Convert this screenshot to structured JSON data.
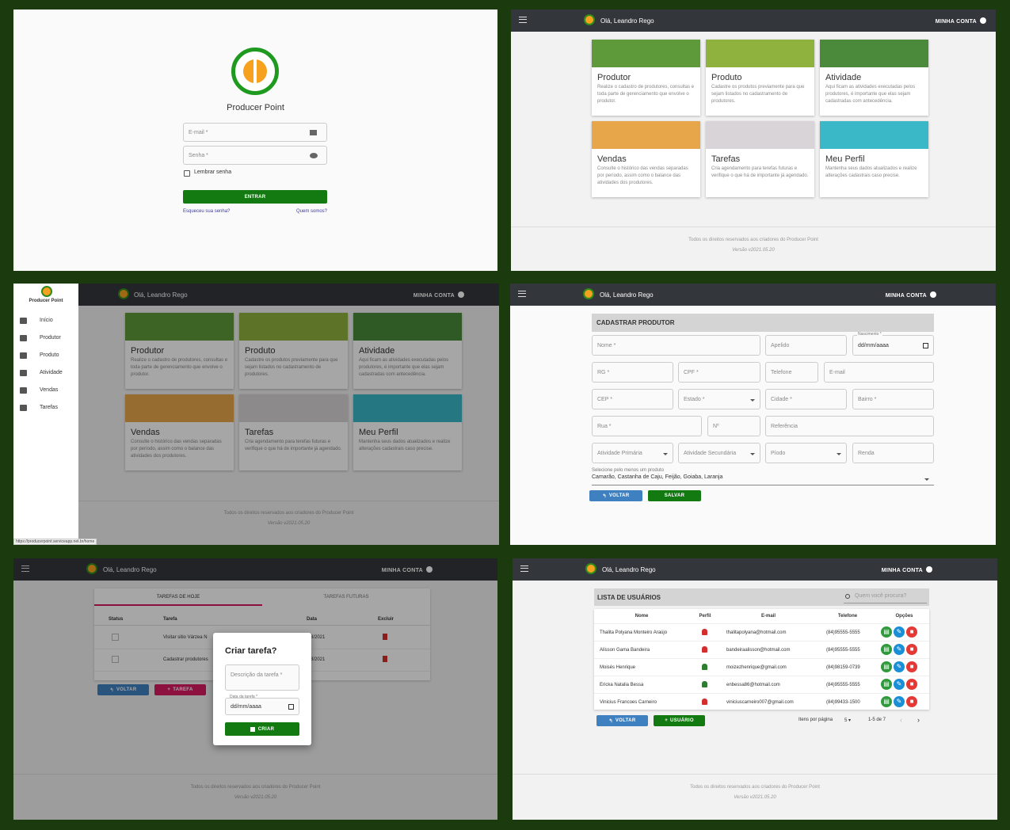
{
  "login": {
    "app_name": "Producer Point",
    "email_placeholder": "E-mail *",
    "password_placeholder": "Senha *",
    "remember_label": "Lembrar senha",
    "enter_button": "ENTRAR",
    "forgot_link": "Esqueceu sua senha?",
    "about_link": "Quem somos?"
  },
  "topbar": {
    "greeting": "Olá, Leandro Rego",
    "account": "MINHA CONTA"
  },
  "home_cards": [
    {
      "title": "Produtor",
      "desc": "Realize o cadastro de produtores, consultas e toda parte de gerenciamento que envolve o produtor.",
      "img_color": "#5e9a3a"
    },
    {
      "title": "Produto",
      "desc": "Cadastre os produtos previamente para que sejam listados no cadastramento de produtores.",
      "img_color": "#8fb23e"
    },
    {
      "title": "Atividade",
      "desc": "Aqui ficam as atividades executadas pelos produtores, é importante que elas sejam cadastradas com antecedência.",
      "img_color": "#4a8a3a"
    },
    {
      "title": "Vendas",
      "desc": "Consulte o histórico das vendas separadas por período, assim como o balance das atividades dos produtores.",
      "img_color": "#e8a64a"
    },
    {
      "title": "Tarefas",
      "desc": "Cria agendamento para terefas futuras e verifique o que há de importante já agendado.",
      "img_color": "#d9d4d8"
    },
    {
      "title": "Meu Perfil",
      "desc": "Mantenha seus dados atualizados e realize alterações cadastrais caso precise.",
      "img_color": "#3ab8c8"
    }
  ],
  "footer": {
    "rights": "Todos os direitos reservados aos criadores do Producer Point",
    "version": "Versão v2021.05.20"
  },
  "sidebar": {
    "brand": "Producer Point",
    "items": [
      {
        "label": "Início",
        "icon": "home-icon"
      },
      {
        "label": "Produtor",
        "icon": "hat-icon"
      },
      {
        "label": "Produto",
        "icon": "bowl-icon"
      },
      {
        "label": "Atividade",
        "icon": "briefcase-icon"
      },
      {
        "label": "Vendas",
        "icon": "trending-up-icon"
      },
      {
        "label": "Tarefas",
        "icon": "clipboard-icon"
      }
    ],
    "status_url": "https://producerpoint.serviceapp.net.br/home"
  },
  "producer_form": {
    "title": "CADASTRAR PRODUTOR",
    "nome": "Nome *",
    "apelido": "Apelido",
    "nascimento_label": "Nascimento *",
    "nascimento": "dd/mm/aaaa",
    "rg": "RG *",
    "cpf": "CPF *",
    "telefone": "Telefone",
    "email": "E-mail",
    "cep": "CEP *",
    "estado": "Estado *",
    "cidade": "Cidade *",
    "bairro": "Bairro *",
    "rua": "Rua *",
    "numero": "Nº",
    "referencia": "Referência",
    "atividade_primaria": "Atividade Primária",
    "atividade_secundaria": "Atividade Secundária",
    "periodo": "Píodo",
    "renda": "Renda",
    "produtos_label": "Selecione pelo menos um produto",
    "produtos_value": "Camarão, Castanha de Caju, Feijão, Goiaba, Laranja",
    "voltar": "VOLTAR",
    "salvar": "SALVAR"
  },
  "tasks": {
    "tab_today": "TAREFAS DE HOJE",
    "tab_future": "TAREFAS FUTURAS",
    "headers": [
      "Status",
      "Tarefa",
      "Data",
      "Excluir"
    ],
    "rows": [
      {
        "task": "Visitar sitio Várzea N",
        "date": "/08/2021"
      },
      {
        "task": "Cadastrar produtores",
        "date": "/08/2021"
      }
    ],
    "voltar": "VOLTAR",
    "tarefa": "TAREFA",
    "dialog_title": "Criar tarefa?",
    "desc_placeholder": "Descrição da tarefa *",
    "date_label": "Data da tarefa *",
    "date_value": "dd/mm/aaaa",
    "create": "CRIAR"
  },
  "users": {
    "title": "LISTA DE USUÁRIOS",
    "search_placeholder": "Quem você procura?",
    "headers": [
      "Nome",
      "Perfil",
      "E-mail",
      "Telefone",
      "Opções"
    ],
    "rows": [
      {
        "name": "Thalita Polyana Monteiro Araújo",
        "profile_color": "#d32f2f",
        "email": "thalitapolyana@hotmail.com",
        "phone": "(84)95555-5555"
      },
      {
        "name": "Alisson Gama Bandeira",
        "profile_color": "#d32f2f",
        "email": "bandeiraalisson@hotmail.com",
        "phone": "(84)95555-5555"
      },
      {
        "name": "Moisés Henrique",
        "profile_color": "#2e7d32",
        "email": "moizezhenrique@gmail.com",
        "phone": "(84)98159-0739"
      },
      {
        "name": "Ericka Natalia Bessa",
        "profile_color": "#2e7d32",
        "email": "enbessa86@hotmail.com",
        "phone": "(84)95555-5555"
      },
      {
        "name": "Vinicius Francoes Carneiro",
        "profile_color": "#d32f2f",
        "email": "viniciuscarneiro007@gmail.com",
        "phone": "(84)99433-1500"
      }
    ],
    "voltar": "VOLTAR",
    "usuario": "USUÁRIO",
    "per_page_label": "Itens por página",
    "per_page": "5",
    "range": "1-5 de 7"
  }
}
